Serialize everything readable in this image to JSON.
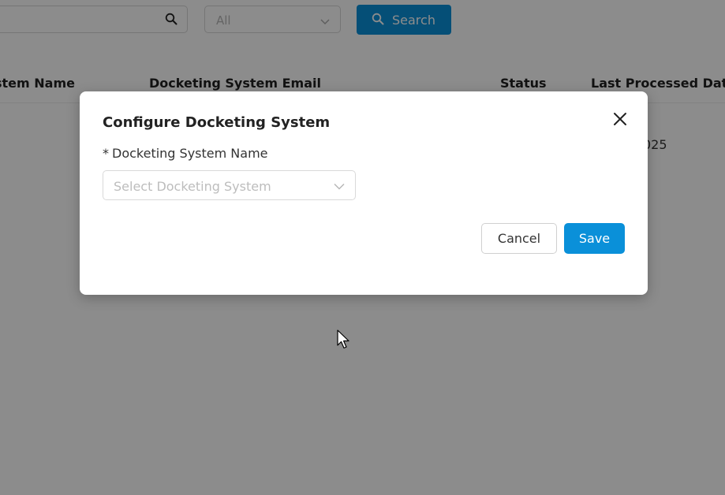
{
  "background": {
    "search": {
      "icon": "search-icon"
    },
    "filter": {
      "value": "All",
      "icon": "chevron-down-icon"
    },
    "search_button": {
      "label": "Search",
      "icon": "search-icon"
    },
    "table": {
      "headers": [
        "stem Name",
        "Docketing System Email",
        "Status",
        "Last Processed Date"
      ],
      "row_partial_date": "025"
    }
  },
  "modal": {
    "title": "Configure Docketing System",
    "close_icon": "close-icon",
    "field": {
      "required_mark": "*",
      "label": "Docketing System Name",
      "placeholder": "Select Docketing System",
      "icon": "chevron-down-icon"
    },
    "cancel_label": "Cancel",
    "save_label": "Save"
  },
  "colors": {
    "primary": "#0a90d9",
    "overlay": "rgba(0,0,0,0.45)"
  }
}
